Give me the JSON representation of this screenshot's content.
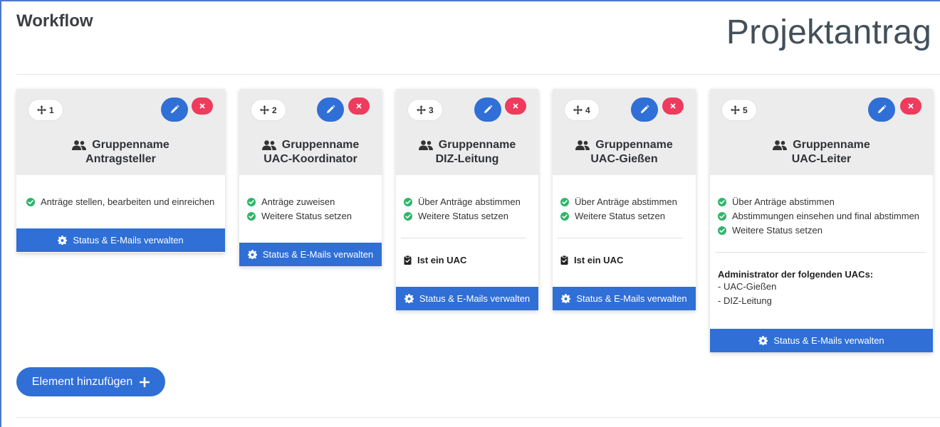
{
  "header": {
    "title": "Workflow",
    "workflow_name": "Projektantrag"
  },
  "cards": [
    {
      "order": "1",
      "group_prefix": "Gruppenname",
      "group": "Antragsteller",
      "permissions": [
        "Anträge stellen, bearbeiten und einreichen"
      ],
      "status_button": "Status & E-Mails verwalten"
    },
    {
      "order": "2",
      "group_prefix": "Gruppenname",
      "group": "UAC-Koordinator",
      "permissions": [
        "Anträge zuweisen",
        "Weitere Status setzen"
      ],
      "status_button": "Status & E-Mails verwalten"
    },
    {
      "order": "3",
      "group_prefix": "Gruppenname",
      "group": "DIZ-Leitung",
      "permissions": [
        "Über Anträge abstimmen",
        "Weitere Status setzen"
      ],
      "uac_flag": "Ist ein UAC",
      "status_button": "Status & E-Mails verwalten"
    },
    {
      "order": "4",
      "group_prefix": "Gruppenname",
      "group": "UAC-Gießen",
      "permissions": [
        "Über Anträge abstimmen",
        "Weitere Status setzen"
      ],
      "uac_flag": "Ist ein UAC",
      "status_button": "Status & E-Mails verwalten"
    },
    {
      "order": "5",
      "group_prefix": "Gruppenname",
      "group": "UAC-Leiter",
      "permissions": [
        "Über Anträge abstimmen",
        "Abstimmungen einsehen und final abstimmen",
        "Weitere Status setzen"
      ],
      "admin_title": "Administrator der folgenden UACs:",
      "admin_items": [
        "- UAC-Gießen",
        "- DIZ-Leitung"
      ],
      "status_button": "Status & E-Mails verwalten"
    }
  ],
  "add_button": "Element hinzufügen",
  "icons": {
    "order": "move-icon",
    "group": "users-icon",
    "perm": "check-circle-icon",
    "edit": "pencil-icon",
    "delete": "close-icon",
    "uac": "clipboard-check-icon",
    "status": "cog-icon",
    "add": "plus-icon"
  },
  "colors": {
    "primary": "#2f6fd6",
    "danger": "#ef3b5d",
    "success": "#2fb56a",
    "card_head": "#ececec"
  }
}
